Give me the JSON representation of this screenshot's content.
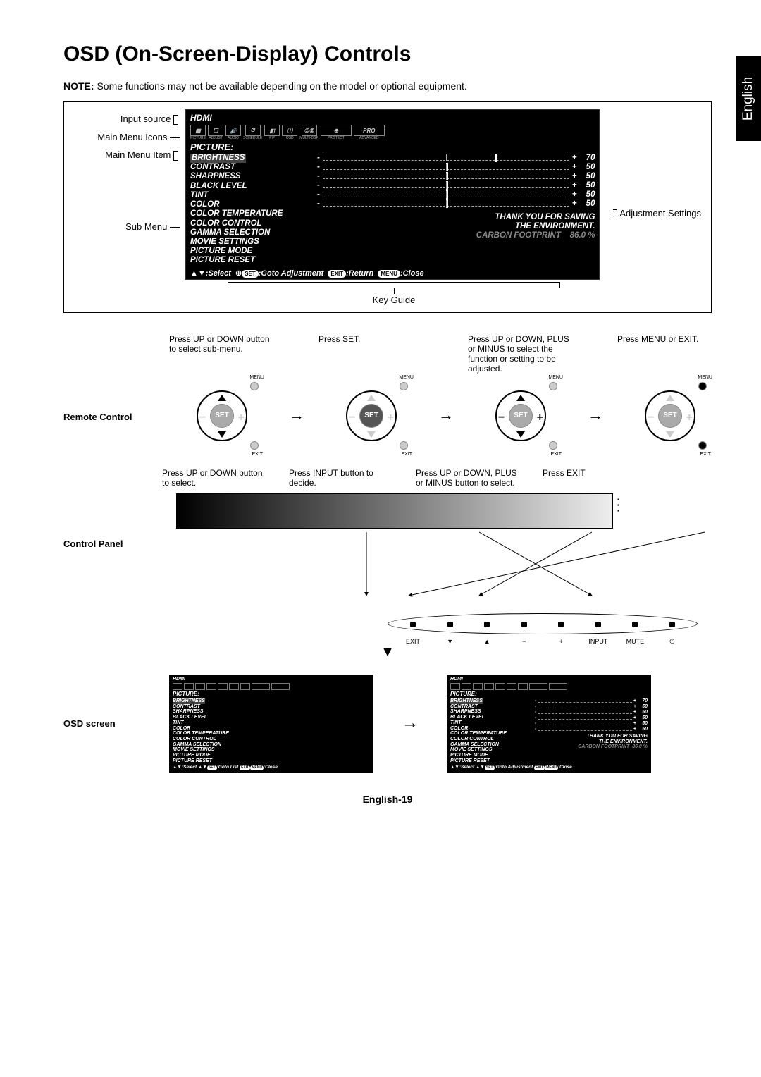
{
  "language_tab": "English",
  "heading": "OSD (On-Screen-Display) Controls",
  "note_label": "NOTE:",
  "note_text": "Some functions may not be available depending on the model or optional equipment.",
  "labels": {
    "input_source": "Input source",
    "main_menu_icons": "Main Menu Icons",
    "main_menu_item": "Main Menu Item",
    "sub_menu": "Sub Menu",
    "adjustment_settings": "Adjustment Settings",
    "key_guide": "Key Guide"
  },
  "osd": {
    "source": "HDMI",
    "menu_title": "PICTURE:",
    "icons": [
      "PICTURE",
      "ADJUST",
      "AUDIO",
      "SCHEDULE",
      "PIP",
      "OSD",
      "MULTI-DSP",
      "PROTECT",
      "ADVANCED"
    ],
    "items": [
      {
        "name": "BRIGHTNESS",
        "value": 70,
        "slider": true,
        "selected": true
      },
      {
        "name": "CONTRAST",
        "value": 50,
        "slider": true
      },
      {
        "name": "SHARPNESS",
        "value": 50,
        "slider": true
      },
      {
        "name": "BLACK LEVEL",
        "value": 50,
        "slider": true
      },
      {
        "name": "TINT",
        "value": 50,
        "slider": true
      },
      {
        "name": "COLOR",
        "value": 50,
        "slider": true
      },
      {
        "name": "COLOR TEMPERATURE"
      },
      {
        "name": "COLOR CONTROL"
      },
      {
        "name": "GAMMA SELECTION"
      },
      {
        "name": "MOVIE SETTINGS"
      },
      {
        "name": "PICTURE MODE"
      },
      {
        "name": "PICTURE RESET"
      }
    ],
    "env_line1": "THANK YOU FOR SAVING",
    "env_line2": "THE ENVIRONMENT.",
    "carbon_label": "CARBON FOOTPRINT",
    "carbon_value": "86.0 %",
    "keyguide_select": ":Select",
    "keyguide_goto": ":Goto Adjustment",
    "keyguide_return": ":Return",
    "keyguide_close": ":Close",
    "keyguide_goto_list": ":Goto List",
    "pill_set": "SET",
    "pill_exit": "EXIT",
    "pill_menu": "MENU"
  },
  "remote": {
    "row_label": "Remote Control",
    "step1": "Press UP or DOWN button to select sub-menu.",
    "step2": "Press SET.",
    "step3": "Press UP or DOWN, PLUS or MINUS to select the function or setting to be adjusted.",
    "step4": "Press MENU or EXIT.",
    "set_label": "SET",
    "menu_label": "MENU",
    "exit_label": "EXIT"
  },
  "control_panel": {
    "row_label": "Control Panel",
    "step1": "Press UP or DOWN button to select.",
    "step2": "Press INPUT button to decide.",
    "step3": "Press UP or DOWN, PLUS or MINUS button to select.",
    "step4": "Press EXIT",
    "buttons": [
      "EXIT",
      "▼",
      "▲",
      "−",
      "+",
      "INPUT",
      "MUTE",
      "⏻"
    ]
  },
  "osd_screen": {
    "row_label": "OSD screen"
  },
  "footer": "English-19"
}
